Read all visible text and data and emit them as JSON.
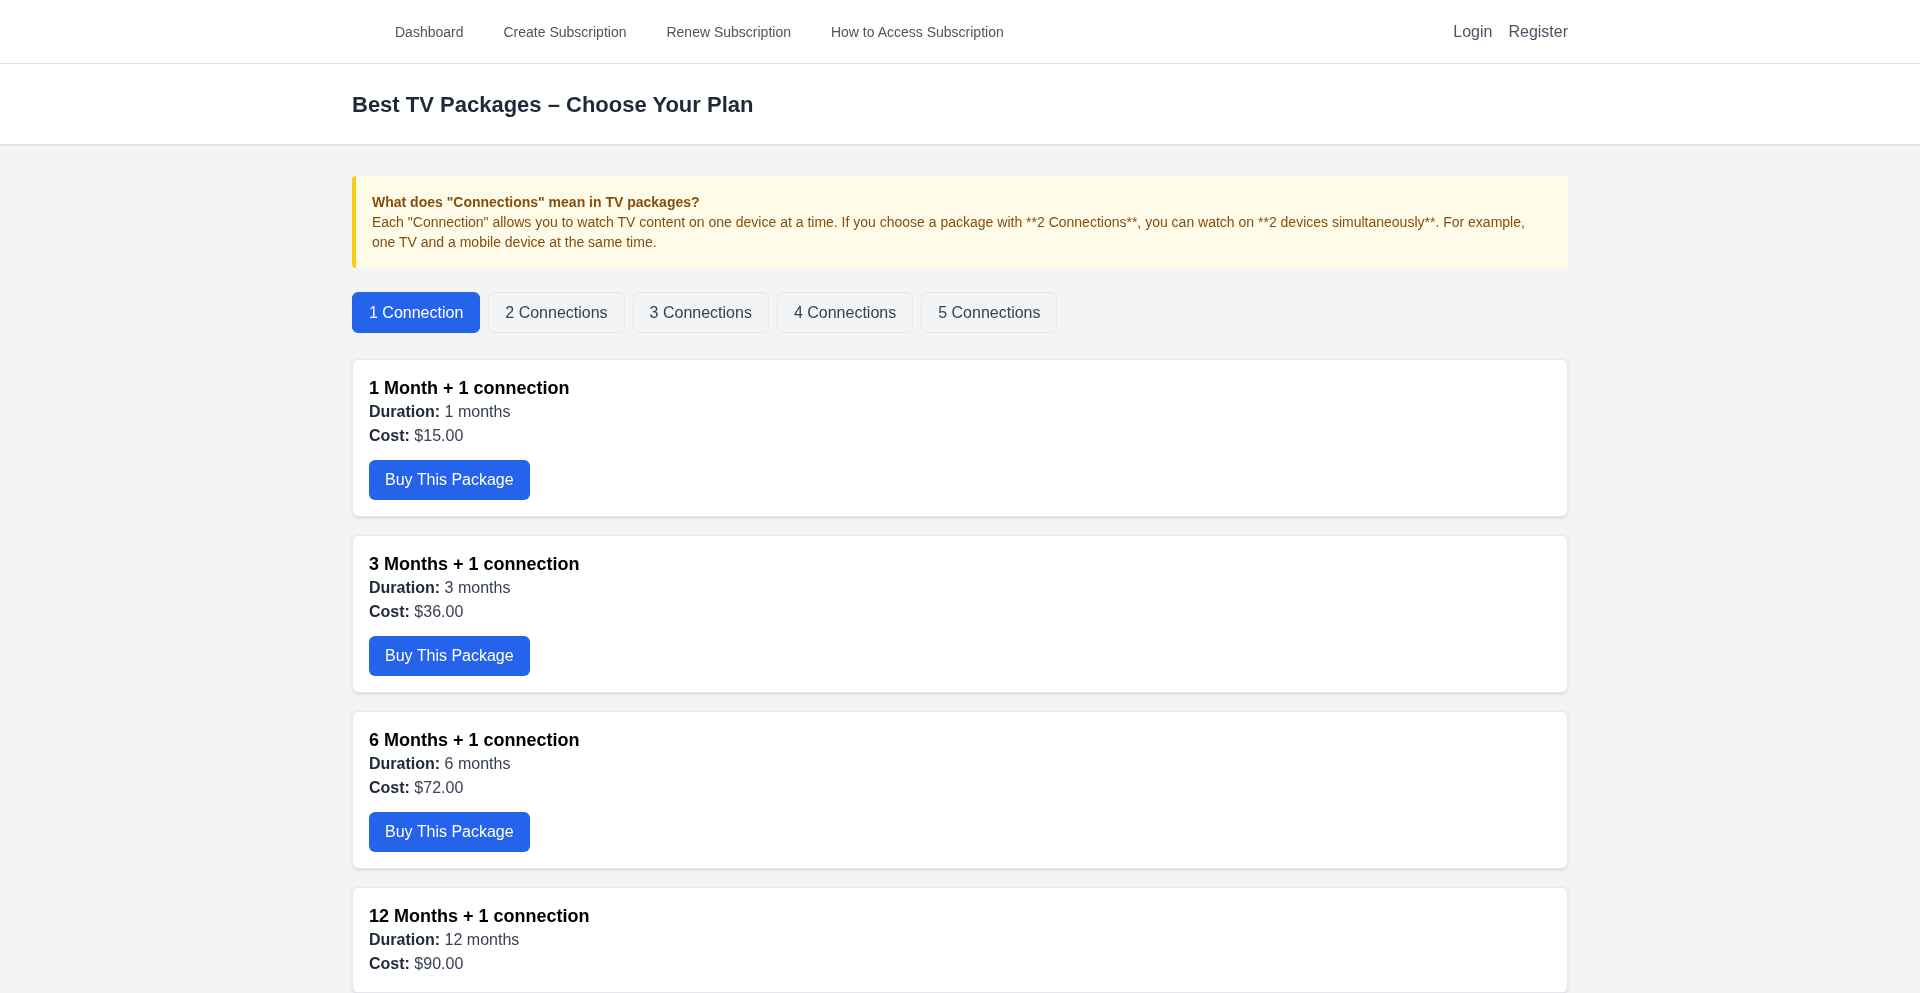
{
  "nav": {
    "links": [
      "Dashboard",
      "Create Subscription",
      "Renew Subscription",
      "How to Access Subscription"
    ],
    "auth": [
      "Login",
      "Register"
    ]
  },
  "header": {
    "title": "Best TV Packages – Choose Your Plan"
  },
  "notice": {
    "title": "What does \"Connections\" mean in TV packages?",
    "text": "Each \"Connection\" allows you to watch TV content on one device at a time. If you choose a package with **2 Connections**, you can watch on **2 devices simultaneously**. For example, one TV and a mobile device at the same time."
  },
  "tabs": [
    {
      "label": "1 Connection",
      "selected": true
    },
    {
      "label": "2 Connections",
      "selected": false
    },
    {
      "label": "3 Connections",
      "selected": false
    },
    {
      "label": "4 Connections",
      "selected": false
    },
    {
      "label": "5 Connections",
      "selected": false
    }
  ],
  "packages": [
    {
      "title": "1 Month + 1 connection",
      "duration_label": "Duration:",
      "duration": "1 months",
      "cost_label": "Cost:",
      "cost": "$15.00",
      "button": "Buy This Package"
    },
    {
      "title": "3 Months + 1 connection",
      "duration_label": "Duration:",
      "duration": "3 months",
      "cost_label": "Cost:",
      "cost": "$36.00",
      "button": "Buy This Package"
    },
    {
      "title": "6 Months + 1 connection",
      "duration_label": "Duration:",
      "duration": "6 months",
      "cost_label": "Cost:",
      "cost": "$72.00",
      "button": "Buy This Package"
    },
    {
      "title": "12 Months + 1 connection",
      "duration_label": "Duration:",
      "duration": "12 months",
      "cost_label": "Cost:",
      "cost": "$90.00"
    }
  ]
}
